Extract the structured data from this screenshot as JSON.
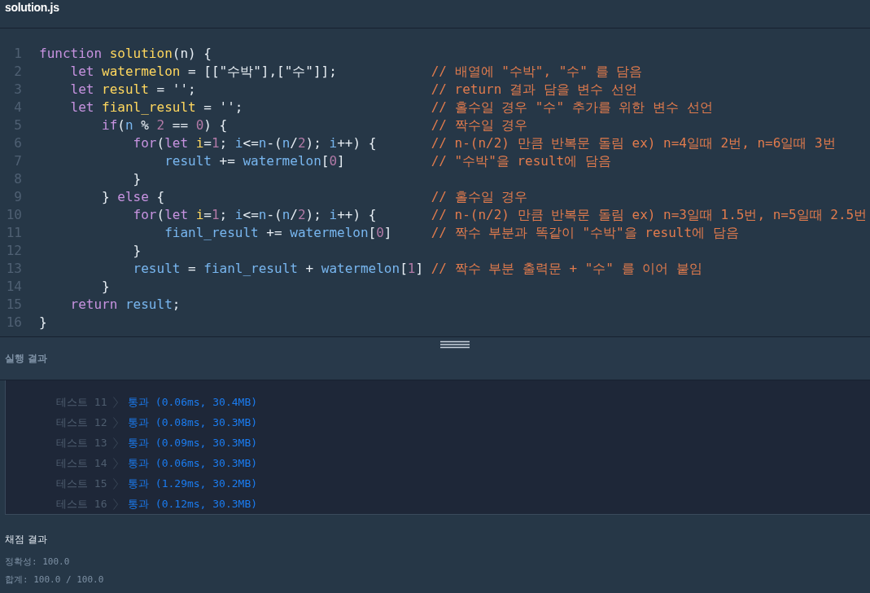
{
  "editor": {
    "file_tab": "solution.js",
    "lines": [
      {
        "n": "1",
        "code": [
          {
            "text": "function ",
            "kind": "kw"
          },
          {
            "text": "solution",
            "kind": "def"
          },
          {
            "text": "(n) {",
            "kind": "plain"
          }
        ]
      },
      {
        "n": "2",
        "code": [
          {
            "text": "    let ",
            "kind": "kw"
          },
          {
            "text": "watermelon",
            "kind": "def"
          },
          {
            "text": " = [[\"수박\"],[\"수\"]];",
            "kind": "plain"
          }
        ],
        "comment": "// 배열에 \"수박\", \"수\" 를 담음"
      },
      {
        "n": "3",
        "code": [
          {
            "text": "    let ",
            "kind": "kw"
          },
          {
            "text": "result",
            "kind": "def"
          },
          {
            "text": " = '';",
            "kind": "plain"
          }
        ],
        "comment": "// return 결과 담을 변수 선언"
      },
      {
        "n": "4",
        "code": [
          {
            "text": "    let ",
            "kind": "kw"
          },
          {
            "text": "fianl_result",
            "kind": "def"
          },
          {
            "text": " = '';",
            "kind": "plain"
          }
        ],
        "comment": "// 홀수일 경우 \"수\" 추가를 위한 변수 선언"
      },
      {
        "n": "5",
        "code": [
          {
            "text": "        if",
            "kind": "kw"
          },
          {
            "text": "(",
            "kind": "plain"
          },
          {
            "text": "n",
            "kind": "var"
          },
          {
            "text": " % ",
            "kind": "plain"
          },
          {
            "text": "2",
            "kind": "num"
          },
          {
            "text": " == ",
            "kind": "plain"
          },
          {
            "text": "0",
            "kind": "num"
          },
          {
            "text": ") {",
            "kind": "plain"
          }
        ],
        "comment": "// 짝수일 경우"
      },
      {
        "n": "6",
        "code": [
          {
            "text": "            for",
            "kind": "kw"
          },
          {
            "text": "(",
            "kind": "plain"
          },
          {
            "text": "let ",
            "kind": "kw"
          },
          {
            "text": "i",
            "kind": "def"
          },
          {
            "text": "=",
            "kind": "plain"
          },
          {
            "text": "1",
            "kind": "num"
          },
          {
            "text": "; ",
            "kind": "plain"
          },
          {
            "text": "i",
            "kind": "var"
          },
          {
            "text": "<=",
            "kind": "plain"
          },
          {
            "text": "n",
            "kind": "var"
          },
          {
            "text": "-(",
            "kind": "plain"
          },
          {
            "text": "n",
            "kind": "var"
          },
          {
            "text": "/",
            "kind": "plain"
          },
          {
            "text": "2",
            "kind": "num"
          },
          {
            "text": "); ",
            "kind": "plain"
          },
          {
            "text": "i",
            "kind": "var"
          },
          {
            "text": "++) {",
            "kind": "plain"
          }
        ],
        "comment": "// n-(n/2) 만큼 반복문 돌림 ex) n=4일때 2번, n=6일때 3번"
      },
      {
        "n": "7",
        "code": [
          {
            "text": "                result",
            "kind": "var"
          },
          {
            "text": " += ",
            "kind": "plain"
          },
          {
            "text": "watermelon",
            "kind": "var"
          },
          {
            "text": "[",
            "kind": "plain"
          },
          {
            "text": "0",
            "kind": "num"
          },
          {
            "text": "]",
            "kind": "plain"
          }
        ],
        "comment": "// \"수박\"을 result에 담음"
      },
      {
        "n": "8",
        "code": [
          {
            "text": "            }",
            "kind": "plain"
          }
        ]
      },
      {
        "n": "9",
        "code": [
          {
            "text": "        } ",
            "kind": "plain"
          },
          {
            "text": "else",
            "kind": "kw"
          },
          {
            "text": " {",
            "kind": "plain"
          }
        ],
        "comment": "// 홀수일 경우"
      },
      {
        "n": "10",
        "code": [
          {
            "text": "            for",
            "kind": "kw"
          },
          {
            "text": "(",
            "kind": "plain"
          },
          {
            "text": "let ",
            "kind": "kw"
          },
          {
            "text": "i",
            "kind": "def"
          },
          {
            "text": "=",
            "kind": "plain"
          },
          {
            "text": "1",
            "kind": "num"
          },
          {
            "text": "; ",
            "kind": "plain"
          },
          {
            "text": "i",
            "kind": "var"
          },
          {
            "text": "<=",
            "kind": "plain"
          },
          {
            "text": "n",
            "kind": "var"
          },
          {
            "text": "-(",
            "kind": "plain"
          },
          {
            "text": "n",
            "kind": "var"
          },
          {
            "text": "/",
            "kind": "plain"
          },
          {
            "text": "2",
            "kind": "num"
          },
          {
            "text": "); ",
            "kind": "plain"
          },
          {
            "text": "i",
            "kind": "var"
          },
          {
            "text": "++) {",
            "kind": "plain"
          }
        ],
        "comment": "// n-(n/2) 만큼 반복문 돌림 ex) n=3일때 1.5번, n=5일때 2.5번"
      },
      {
        "n": "11",
        "code": [
          {
            "text": "                fianl_result",
            "kind": "var"
          },
          {
            "text": " += ",
            "kind": "plain"
          },
          {
            "text": "watermelon",
            "kind": "var"
          },
          {
            "text": "[",
            "kind": "plain"
          },
          {
            "text": "0",
            "kind": "num"
          },
          {
            "text": "]",
            "kind": "plain"
          }
        ],
        "comment": "// 짝수 부분과 똑같이 \"수박\"을 result에 담음"
      },
      {
        "n": "12",
        "code": [
          {
            "text": "            }",
            "kind": "plain"
          }
        ]
      },
      {
        "n": "13",
        "code": [
          {
            "text": "            result",
            "kind": "var"
          },
          {
            "text": " = ",
            "kind": "plain"
          },
          {
            "text": "fianl_result",
            "kind": "var"
          },
          {
            "text": " + ",
            "kind": "plain"
          },
          {
            "text": "watermelon",
            "kind": "var"
          },
          {
            "text": "[",
            "kind": "plain"
          },
          {
            "text": "1",
            "kind": "num"
          },
          {
            "text": "]",
            "kind": "plain"
          }
        ],
        "comment": "// 짝수 부분 출력문 + \"수\" 를 이어 붙임"
      },
      {
        "n": "14",
        "code": [
          {
            "text": "        }",
            "kind": "plain"
          }
        ]
      },
      {
        "n": "15",
        "code": [
          {
            "text": "    return ",
            "kind": "kw"
          },
          {
            "text": "result",
            "kind": "var"
          },
          {
            "text": ";",
            "kind": "plain"
          }
        ]
      },
      {
        "n": "16",
        "code": [
          {
            "text": "}",
            "kind": "plain"
          }
        ]
      }
    ]
  },
  "run_results": {
    "title": "실행 결과",
    "rows": [
      {
        "label": "테스트 11",
        "result": "통과 (0.06ms, 30.4MB)"
      },
      {
        "label": "테스트 12",
        "result": "통과 (0.08ms, 30.3MB)"
      },
      {
        "label": "테스트 13",
        "result": "통과 (0.09ms, 30.3MB)"
      },
      {
        "label": "테스트 14",
        "result": "통과 (0.06ms, 30.3MB)"
      },
      {
        "label": "테스트 15",
        "result": "통과 (1.29ms, 30.2MB)"
      },
      {
        "label": "테스트 16",
        "result": "통과 (0.12ms, 30.3MB)"
      }
    ]
  },
  "grading": {
    "title": "채점 결과",
    "lines": [
      "정확성: 100.0",
      "합계: 100.0 / 100.0"
    ]
  }
}
